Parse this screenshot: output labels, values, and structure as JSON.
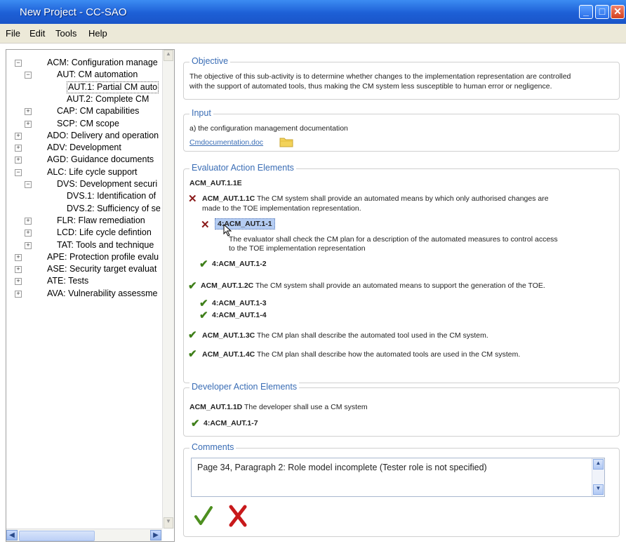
{
  "window": {
    "title": "New Project - CC-SAO"
  },
  "menu": [
    "File",
    "Edit",
    "Tools",
    "Help"
  ],
  "tree": {
    "items": [
      {
        "label": "ACM: Configuration manage",
        "level": 0,
        "exp": "minus"
      },
      {
        "label": "AUT: CM automation",
        "level": 1,
        "exp": "minus"
      },
      {
        "label": "AUT.1: Partial CM auto",
        "level": 2,
        "exp": "none",
        "selected": true
      },
      {
        "label": "AUT.2: Complete CM",
        "level": 2,
        "exp": "none"
      },
      {
        "label": "CAP: CM capabilities",
        "level": 1,
        "exp": "plus"
      },
      {
        "label": "SCP: CM scope",
        "level": 1,
        "exp": "plus"
      },
      {
        "label": "ADO: Delivery and operation",
        "level": 0,
        "exp": "plus"
      },
      {
        "label": "ADV: Development",
        "level": 0,
        "exp": "plus"
      },
      {
        "label": "AGD: Guidance documents",
        "level": 0,
        "exp": "plus"
      },
      {
        "label": "ALC: Life cycle support",
        "level": 0,
        "exp": "minus"
      },
      {
        "label": "DVS: Development securi",
        "level": 1,
        "exp": "minus"
      },
      {
        "label": "DVS.1: Identification of",
        "level": 2,
        "exp": "none"
      },
      {
        "label": "DVS.2: Sufficiency of se",
        "level": 2,
        "exp": "none"
      },
      {
        "label": "FLR: Flaw remediation",
        "level": 1,
        "exp": "plus"
      },
      {
        "label": "LCD: Life cycle defintion",
        "level": 1,
        "exp": "plus"
      },
      {
        "label": "TAT: Tools and technique",
        "level": 1,
        "exp": "plus"
      },
      {
        "label": "APE: Protection profile evalu",
        "level": 0,
        "exp": "plus"
      },
      {
        "label": "ASE: Security target evaluat",
        "level": 0,
        "exp": "plus"
      },
      {
        "label": "ATE: Tests",
        "level": 0,
        "exp": "plus"
      },
      {
        "label": "AVA: Vulnerability assessme",
        "level": 0,
        "exp": "plus"
      }
    ]
  },
  "objective": {
    "legend": "Objective",
    "text1": "The objective of this sub-activity is to determine whether changes to the implementation representation are controlled",
    "text2": "with the support of automated tools, thus making the CM system less susceptible to human error or negligence."
  },
  "input": {
    "legend": "Input",
    "text": "a) the configuration management documentation",
    "file": "Cmdocumentation.doc"
  },
  "evaluator": {
    "legend": "Evaluator Action Elements",
    "heading": "ACM_AUT.1.1E",
    "c1_id": "ACM_AUT.1.1C",
    "c1_text_a": "The CM system shall provide an automated means by which only authorised changes are",
    "c1_text_b": "made to the TOE implementation representation.",
    "u1_id": "4:ACM_AUT.1-1",
    "u1_text_a": "The evaluator shall check the CM plan for a description of the automated measures to control access",
    "u1_text_b": "to the TOE implementation representation",
    "u2_id": "4:ACM_AUT.1-2",
    "c2_id": "ACM_AUT.1.2C",
    "c2_text": "The CM system shall provide an automated means to support the generation of the TOE.",
    "u3_id": "4:ACM_AUT.1-3",
    "u4_id": "4:ACM_AUT.1-4",
    "c3_id": "ACM_AUT.1.3C",
    "c3_text": "The CM plan shall describe the automated tool used in the CM system.",
    "c4_id": "ACM_AUT.1.4C",
    "c4_text": "The CM plan shall describe how the automated tools are used in the CM system."
  },
  "developer": {
    "legend": "Developer Action Elements",
    "d1_id": "ACM_AUT.1.1D",
    "d1_text": "The developer shall use a CM system",
    "u7_id": "4:ACM_AUT.1-7"
  },
  "comments": {
    "legend": "Comments",
    "text": "Page 34, Paragraph 2: Role model incomplete (Tester role is not specified)"
  },
  "colors": {
    "accent": "#3a6db5",
    "check": "#3f7f1a",
    "cross": "#8a1a1a",
    "titlebar": "#1d5fd6"
  },
  "icons": {
    "pass": "checkmark-icon",
    "fail": "cross-icon",
    "folder": "folder-icon",
    "cursor": "mouse-pointer-icon"
  }
}
